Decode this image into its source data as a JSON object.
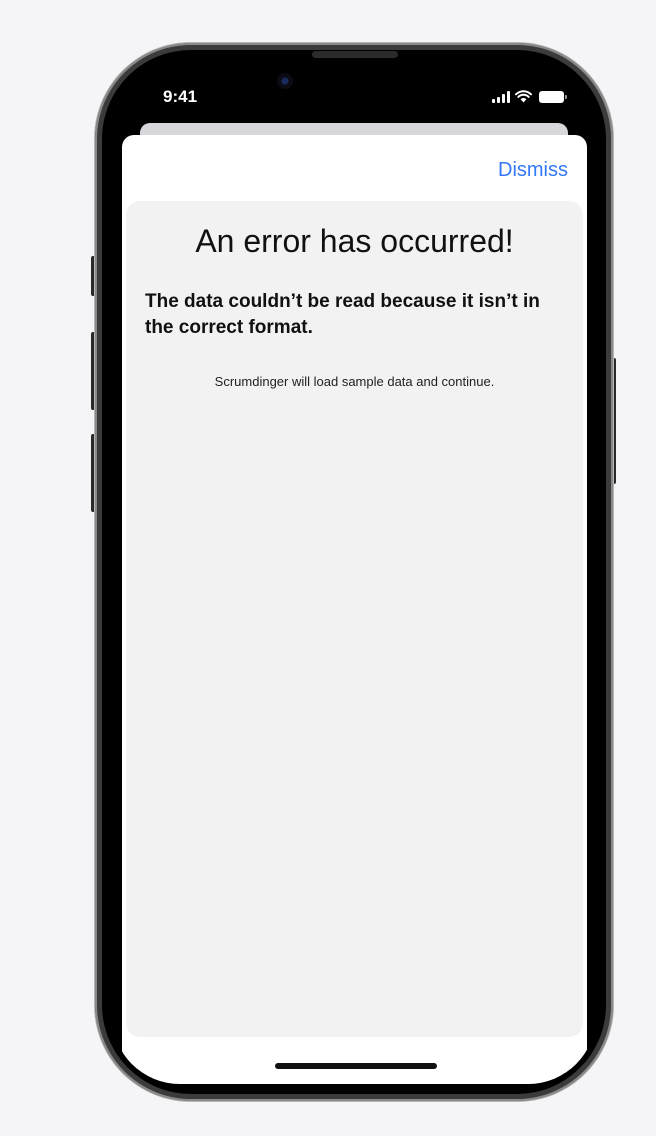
{
  "status_bar": {
    "time": "9:41",
    "signal_icon": "cellular-signal-icon",
    "wifi_icon": "wifi-icon",
    "battery_icon": "battery-icon"
  },
  "sheet": {
    "dismiss_label": "Dismiss"
  },
  "error": {
    "title": "An error has occurred!",
    "message": "The data couldn’t be read because it isn’t in the correct format.",
    "footnote": "Scrumdinger will load sample data and continue."
  },
  "colors": {
    "accent": "#3478f6",
    "card_background": "#f2f2f2",
    "page_background": "#f5f5f7"
  }
}
